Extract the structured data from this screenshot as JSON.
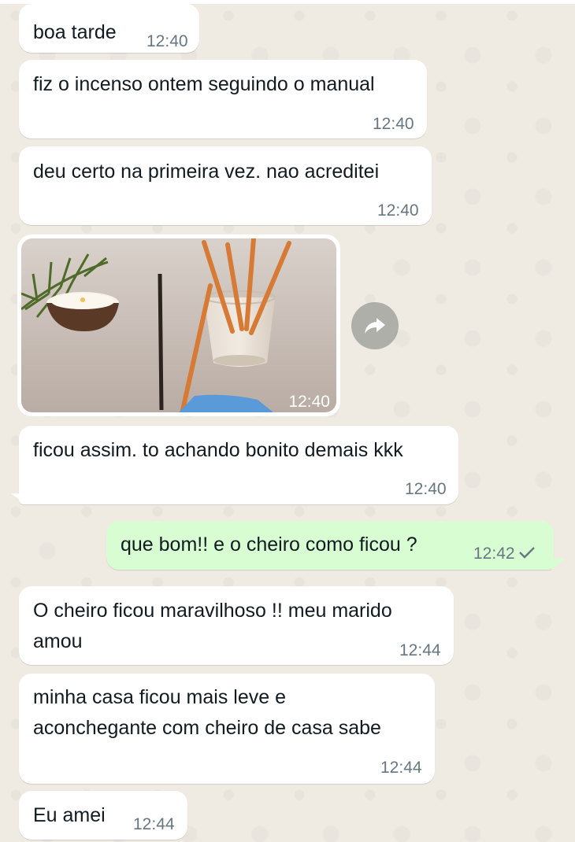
{
  "messages": [
    {
      "text": "boa tarde",
      "time": "12:40"
    },
    {
      "text": "fiz o incenso ontem seguindo o manual",
      "time": "12:40"
    },
    {
      "text": "deu certo na primeira vez. nao acreditei",
      "time": "12:40"
    },
    {
      "media": "photo",
      "time": "12:40"
    },
    {
      "text": "ficou assim. to achando bonito demais kkk",
      "time": "12:40"
    },
    {
      "text": "que bom!! e o cheiro como ficou ?",
      "time": "12:42",
      "status": "sent"
    },
    {
      "lines": [
        "O cheiro ficou maravilhoso !! meu marido",
        "amou"
      ],
      "time": "12:44"
    },
    {
      "lines": [
        "minha casa ficou mais leve e",
        "aconchegante com cheiro de casa sabe"
      ],
      "time": "12:44"
    },
    {
      "text": "Eu amei",
      "time": "12:44"
    }
  ],
  "icons": {
    "forward": "forward-icon",
    "status": "single-check-icon"
  },
  "colors": {
    "incoming_bubble": "#ffffff",
    "outgoing_bubble": "#d9fdd3",
    "chat_background": "#efeae2",
    "timestamp": "#667781"
  }
}
